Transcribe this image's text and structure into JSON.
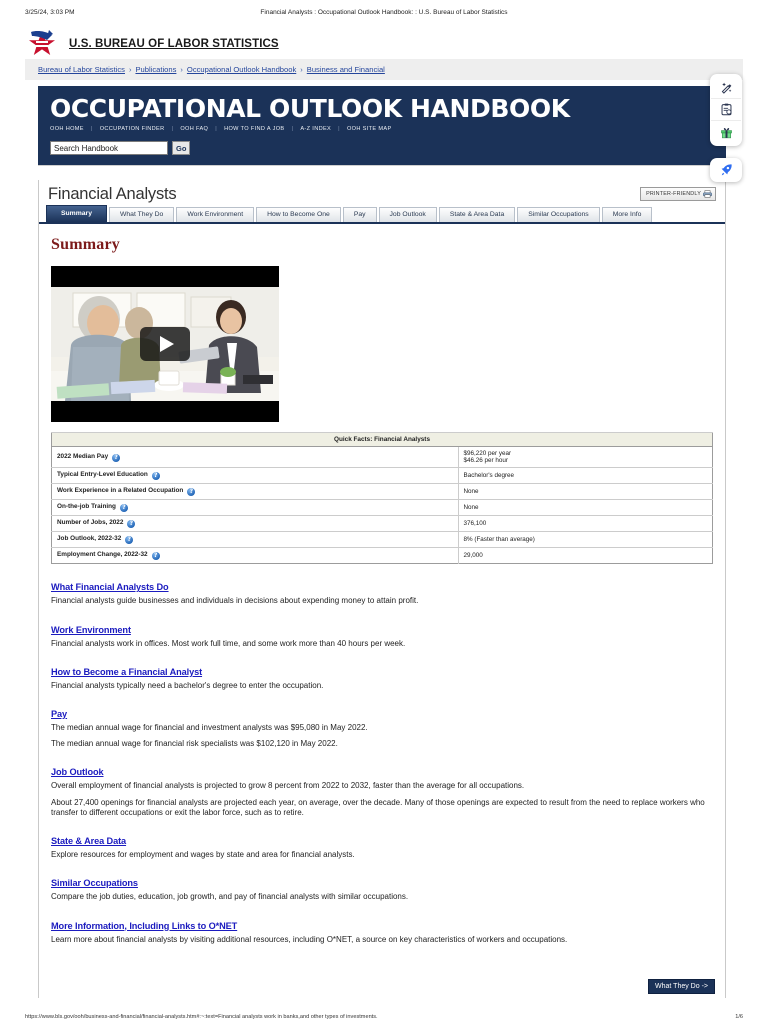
{
  "print": {
    "date": "3/25/24, 3:03 PM",
    "doc_title": "Financial Analysts : Occupational Outlook Handbook: : U.S. Bureau of Labor Statistics",
    "url": "https://www.bls.gov/ooh/business-and-financial/financial-analysts.htm#:~:text=Financial analysts work in banks,and other types of investments.",
    "page_number": "1/6"
  },
  "brand": {
    "name": "U.S. BUREAU OF LABOR STATISTICS",
    "logo_icon": "bls-star-logo"
  },
  "breadcrumb": {
    "separator": "›",
    "items": [
      "Bureau of Labor Statistics",
      "Publications",
      "Occupational Outlook Handbook",
      "Business and Financial"
    ]
  },
  "ooh_banner": {
    "title": "OCCUPATIONAL OUTLOOK HANDBOOK",
    "nav": [
      "OOH HOME",
      "OCCUPATION FINDER",
      "OOH FAQ",
      "HOW TO FIND A JOB",
      "A-Z INDEX",
      "OOH SITE MAP"
    ],
    "nav_separator": "|",
    "search": {
      "value": "Search Handbook",
      "placeholder": "Search Handbook",
      "button_label": "Go"
    }
  },
  "occupation": {
    "title": "Financial Analysts",
    "printer_friendly_label": "PRINTER-FRIENDLY",
    "printer_icon": "printer-icon"
  },
  "tabs": [
    {
      "label": "Summary",
      "active": true
    },
    {
      "label": "What They Do",
      "active": false
    },
    {
      "label": "Work Environment",
      "active": false
    },
    {
      "label": "How to Become One",
      "active": false
    },
    {
      "label": "Pay",
      "active": false
    },
    {
      "label": "Job Outlook",
      "active": false
    },
    {
      "label": "State & Area Data",
      "active": false
    },
    {
      "label": "Similar Occupations",
      "active": false
    },
    {
      "label": "More Info",
      "active": false
    }
  ],
  "main": {
    "heading": "Summary",
    "video": {
      "play_icon": "play-button-icon",
      "caption": ""
    },
    "quick_facts": {
      "caption": "Quick Facts: Financial Analysts",
      "help_icon": "help-question-icon",
      "rows": [
        {
          "label": "2022 Median Pay",
          "values": [
            "$96,220 per year",
            "$46.26 per hour"
          ]
        },
        {
          "label": "Typical Entry-Level Education",
          "values": [
            "Bachelor's degree"
          ]
        },
        {
          "label": "Work Experience in a Related Occupation",
          "values": [
            "None"
          ]
        },
        {
          "label": "On-the-job Training",
          "values": [
            "None"
          ]
        },
        {
          "label": "Number of Jobs, 2022",
          "values": [
            "376,100"
          ]
        },
        {
          "label": "Job Outlook, 2022-32",
          "values": [
            "8% (Faster than average)"
          ]
        },
        {
          "label": "Employment Change, 2022-32",
          "values": [
            "29,000"
          ]
        }
      ]
    },
    "sections": [
      {
        "link": "What Financial Analysts Do",
        "paragraphs": [
          "Financial analysts guide businesses and individuals in decisions about expending money to attain profit."
        ]
      },
      {
        "link": "Work Environment",
        "paragraphs": [
          "Financial analysts work in offices. Most work full time, and some work more than 40 hours per week."
        ]
      },
      {
        "link": "How to Become a Financial Analyst",
        "paragraphs": [
          "Financial analysts typically need a bachelor's degree to enter the occupation."
        ]
      },
      {
        "link": "Pay",
        "paragraphs": [
          "The median annual wage for financial and investment analysts was $95,080 in May 2022.",
          "The median annual wage for financial risk specialists was $102,120 in May 2022."
        ]
      },
      {
        "link": "Job Outlook",
        "paragraphs": [
          "Overall employment of financial analysts is projected to grow 8 percent from 2022 to 2032, faster than the average for all occupations.",
          "About 27,400 openings for financial analysts are projected each year, on average, over the decade. Many of those openings are expected to result from the need to replace workers who transfer to different occupations or exit the labor force, such as to retire."
        ]
      },
      {
        "link": "State & Area Data",
        "paragraphs": [
          "Explore resources for employment and wages by state and area for financial analysts."
        ]
      },
      {
        "link": "Similar Occupations",
        "paragraphs": [
          "Compare the job duties, education, job growth, and pay of financial analysts with similar occupations."
        ]
      },
      {
        "link": "More Information, Including Links to O*NET",
        "paragraphs": [
          "Learn more about financial analysts by visiting additional resources, including O*NET, a source on key characteristics of workers and occupations."
        ]
      }
    ],
    "next_button": "What They Do ->"
  },
  "tool_rail": {
    "items": [
      {
        "icon": "magic-wand-icon",
        "label": ""
      },
      {
        "icon": "clipboard-document-icon",
        "label": ""
      },
      {
        "icon": "gift-icon",
        "label": ""
      }
    ],
    "detached": {
      "icon": "rocket-icon",
      "label": ""
    }
  },
  "colors": {
    "navy": "#1b3258",
    "link_blue": "#1b1bbf",
    "breadcrumb_blue": "#25469c",
    "heading_red": "#7c1a1a",
    "quickfacts_header": "#efefe3"
  }
}
